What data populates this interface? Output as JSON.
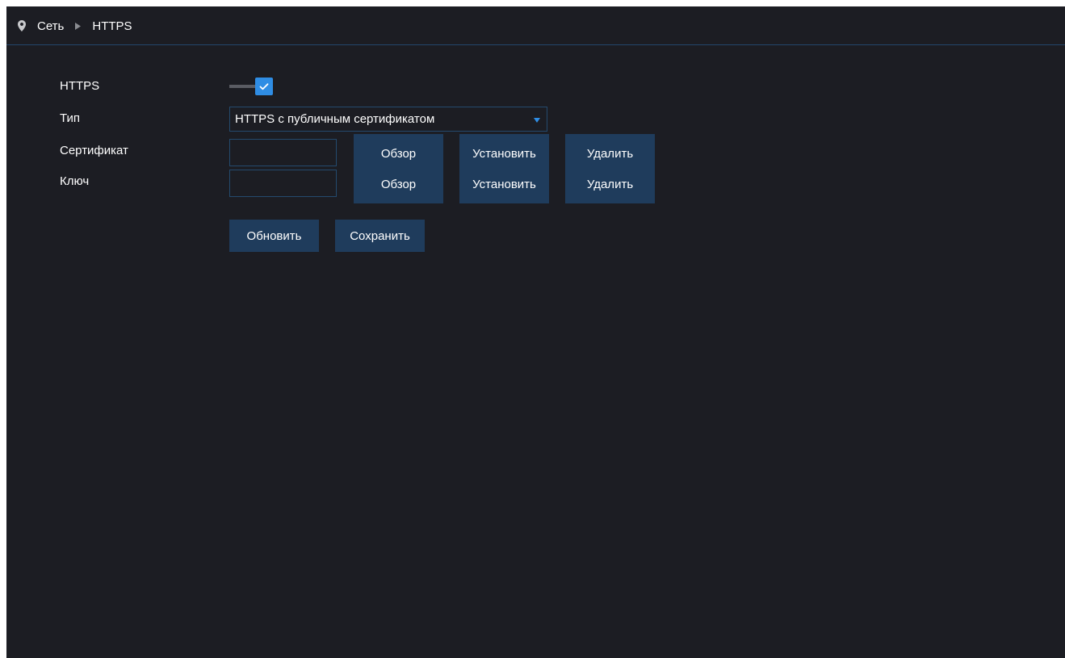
{
  "breadcrumb": {
    "icon": "location-pin-icon",
    "separator_icon": "triangle-right-icon",
    "section": "Сеть",
    "page": "HTTPS"
  },
  "form": {
    "https": {
      "label": "HTTPS",
      "enabled": true
    },
    "type": {
      "label": "Тип",
      "value": "HTTPS с публичным сертификатом"
    },
    "certificate": {
      "label": "Сертификат",
      "value": "",
      "browse_label": "Обзор",
      "install_label": "Установить",
      "delete_label": "Удалить"
    },
    "key": {
      "label": "Ключ",
      "value": "",
      "browse_label": "Обзор",
      "install_label": "Установить",
      "delete_label": "Удалить"
    }
  },
  "actions": {
    "refresh_label": "Обновить",
    "save_label": "Сохранить"
  },
  "colors": {
    "background": "#1c1d23",
    "button": "#1f3c5c",
    "accent": "#2f8de4",
    "border": "#244a6e"
  }
}
